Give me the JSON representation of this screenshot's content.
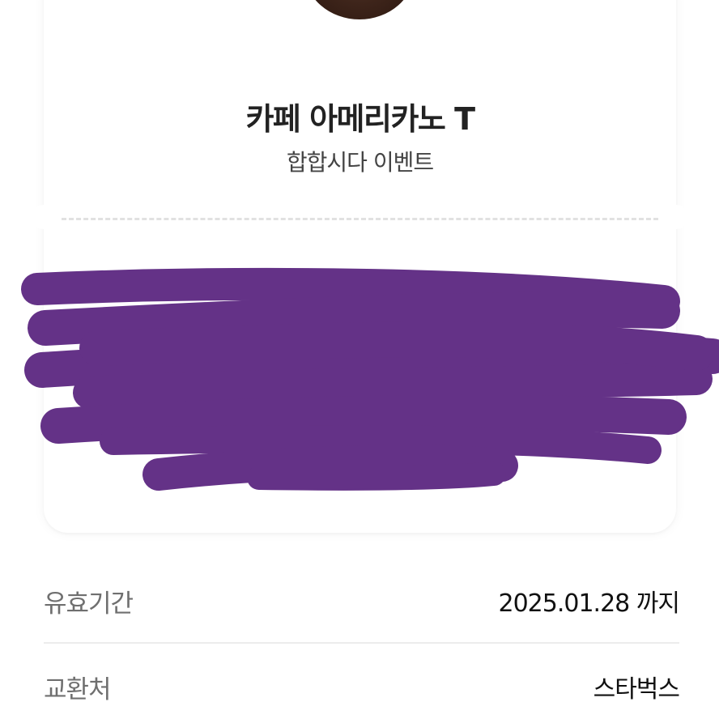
{
  "ticket": {
    "product_name": "카페 아메리카노 T",
    "event_name": "합합시다 이벤트",
    "product_image": "coffee-cup-image",
    "barcode_redacted_color": "#643287"
  },
  "details": {
    "validity_label": "유효기간",
    "validity_value": "2025.01.28 까지",
    "exchange_label": "교환처",
    "exchange_value": "스타벅스"
  }
}
